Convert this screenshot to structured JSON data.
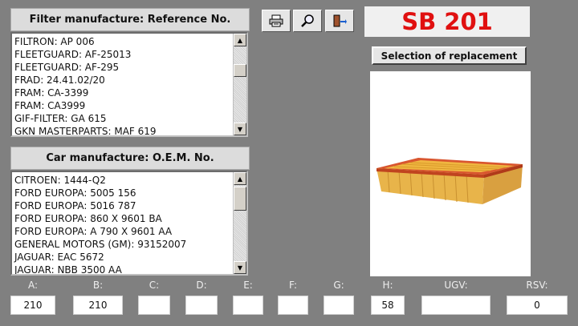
{
  "filter_panel": {
    "header": "Filter manufacture: Reference No.",
    "items": [
      "FILTRON: AP 006",
      "FLEETGUARD: AF-25013",
      "FLEETGUARD: AF-295",
      "FRAD: 24.41.02/20",
      "FRAM: CA-3399",
      "FRAM: CA3999",
      "GIF-FILTER: GA 615",
      "GKN MASTERPARTS: MAF 619"
    ]
  },
  "car_panel": {
    "header": "Car manufacture: O.E.M. No.",
    "items": [
      "CITROEN: 1444-Q2",
      "FORD EUROPA: 5005 156",
      "FORD EUROPA: 5016 787",
      "FORD EUROPA: 860 X 9601 BA",
      "FORD EUROPA: A 790 X 9601 AA",
      "GENERAL MOTORS (GM): 93152007",
      "JAGUAR: EAC 5672",
      "JAGUAR: NBB 3500 AA"
    ]
  },
  "toolbar": {
    "print_icon": "printer-icon",
    "search_icon": "magnifier-icon",
    "exit_icon": "exit-door-icon"
  },
  "product": {
    "title": "SB 201",
    "title_color": "#e01010",
    "replacement_label": "Selection of replacement",
    "image_icon": "air-filter-image"
  },
  "dimensions": [
    {
      "label": "A:",
      "value": "210"
    },
    {
      "label": "B:",
      "value": "210"
    },
    {
      "label": "C:",
      "value": ""
    },
    {
      "label": "D:",
      "value": ""
    },
    {
      "label": "E:",
      "value": ""
    },
    {
      "label": "F:",
      "value": ""
    },
    {
      "label": "G:",
      "value": ""
    },
    {
      "label": "H:",
      "value": "58"
    },
    {
      "label": "UGV:",
      "value": ""
    },
    {
      "label": "RSV:",
      "value": "0"
    }
  ]
}
